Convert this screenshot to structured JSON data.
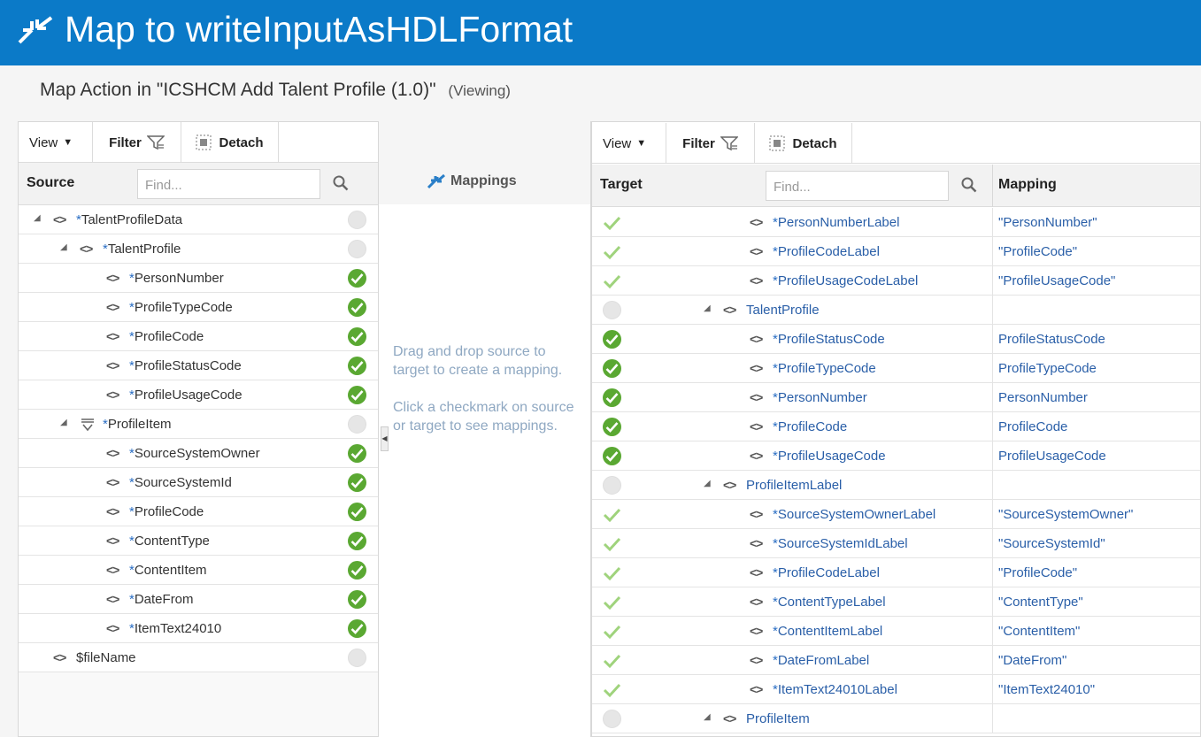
{
  "window": {
    "title": "Map to writeInputAsHDLFormat",
    "subtitle": "Map Action in \"ICSHCM Add Talent Profile (1.0)\"",
    "mode": "(Viewing)"
  },
  "source_panel": {
    "toolbar": {
      "view_label": "View",
      "filter_label": "Filter",
      "detach_label": "Detach"
    },
    "header": {
      "label": "Source",
      "find_placeholder": "Find..."
    },
    "rows": [
      {
        "name": "TalentProfileData",
        "required": true,
        "status": "empty"
      },
      {
        "name": "TalentProfile",
        "required": true,
        "status": "empty"
      },
      {
        "name": "PersonNumber",
        "required": true,
        "status": "check"
      },
      {
        "name": "ProfileTypeCode",
        "required": true,
        "status": "check"
      },
      {
        "name": "ProfileCode",
        "required": true,
        "status": "check"
      },
      {
        "name": "ProfileStatusCode",
        "required": true,
        "status": "check"
      },
      {
        "name": "ProfileUsageCode",
        "required": true,
        "status": "check"
      },
      {
        "name": "ProfileItem",
        "required": true,
        "status": "empty"
      },
      {
        "name": "SourceSystemOwner",
        "required": true,
        "status": "check"
      },
      {
        "name": "SourceSystemId",
        "required": true,
        "status": "check"
      },
      {
        "name": "ProfileCode",
        "required": true,
        "status": "check"
      },
      {
        "name": "ContentType",
        "required": true,
        "status": "check"
      },
      {
        "name": "ContentItem",
        "required": true,
        "status": "check"
      },
      {
        "name": "DateFrom",
        "required": true,
        "status": "check"
      },
      {
        "name": "ItemText24010",
        "required": true,
        "status": "check"
      },
      {
        "name": "$fileName",
        "required": false,
        "status": "empty"
      }
    ]
  },
  "middle": {
    "title": "Mappings",
    "hint1": "Drag and drop source to target to create a mapping.",
    "hint2": "Click a checkmark on source or target to see mappings.",
    "collapse_glyph": "◀"
  },
  "target_panel": {
    "toolbar": {
      "view_label": "View",
      "filter_label": "Filter",
      "detach_label": "Detach"
    },
    "header": {
      "label": "Target",
      "find_placeholder": "Find...",
      "mapping_label": "Mapping"
    },
    "rows": [
      {
        "name": "PersonNumberLabel",
        "required": true,
        "status": "tick",
        "mapping": "\"PersonNumber\""
      },
      {
        "name": "ProfileCodeLabel",
        "required": true,
        "status": "tick",
        "mapping": "\"ProfileCode\""
      },
      {
        "name": "ProfileUsageCodeLabel",
        "required": true,
        "status": "tick",
        "mapping": "\"ProfileUsageCode\""
      },
      {
        "name": "TalentProfile",
        "required": false,
        "status": "empty",
        "mapping": ""
      },
      {
        "name": "ProfileStatusCode",
        "required": true,
        "status": "check",
        "mapping": "ProfileStatusCode"
      },
      {
        "name": "ProfileTypeCode",
        "required": true,
        "status": "check",
        "mapping": "ProfileTypeCode"
      },
      {
        "name": "PersonNumber",
        "required": true,
        "status": "check",
        "mapping": "PersonNumber"
      },
      {
        "name": "ProfileCode",
        "required": true,
        "status": "check",
        "mapping": "ProfileCode"
      },
      {
        "name": "ProfileUsageCode",
        "required": true,
        "status": "check",
        "mapping": "ProfileUsageCode"
      },
      {
        "name": "ProfileItemLabel",
        "required": false,
        "status": "empty",
        "mapping": ""
      },
      {
        "name": "SourceSystemOwnerLabel",
        "required": true,
        "status": "tick",
        "mapping": "\"SourceSystemOwner\""
      },
      {
        "name": "SourceSystemIdLabel",
        "required": true,
        "status": "tick",
        "mapping": "\"SourceSystemId\""
      },
      {
        "name": "ProfileCodeLabel",
        "required": true,
        "status": "tick",
        "mapping": "\"ProfileCode\""
      },
      {
        "name": "ContentTypeLabel",
        "required": true,
        "status": "tick",
        "mapping": "\"ContentType\""
      },
      {
        "name": "ContentItemLabel",
        "required": true,
        "status": "tick",
        "mapping": "\"ContentItem\""
      },
      {
        "name": "DateFromLabel",
        "required": true,
        "status": "tick",
        "mapping": "\"DateFrom\""
      },
      {
        "name": "ItemText24010Label",
        "required": true,
        "status": "tick",
        "mapping": "\"ItemText24010\""
      },
      {
        "name": "ProfileItem",
        "required": false,
        "status": "empty",
        "mapping": ""
      }
    ]
  },
  "glyphs": {
    "element_icon": "<>",
    "required_mark": "*",
    "expand_triangle": "◢"
  },
  "colors": {
    "brand": "#0b7ac8",
    "check": "#5aa832",
    "tick": "#9fd37c",
    "link": "#2a5fa8"
  }
}
